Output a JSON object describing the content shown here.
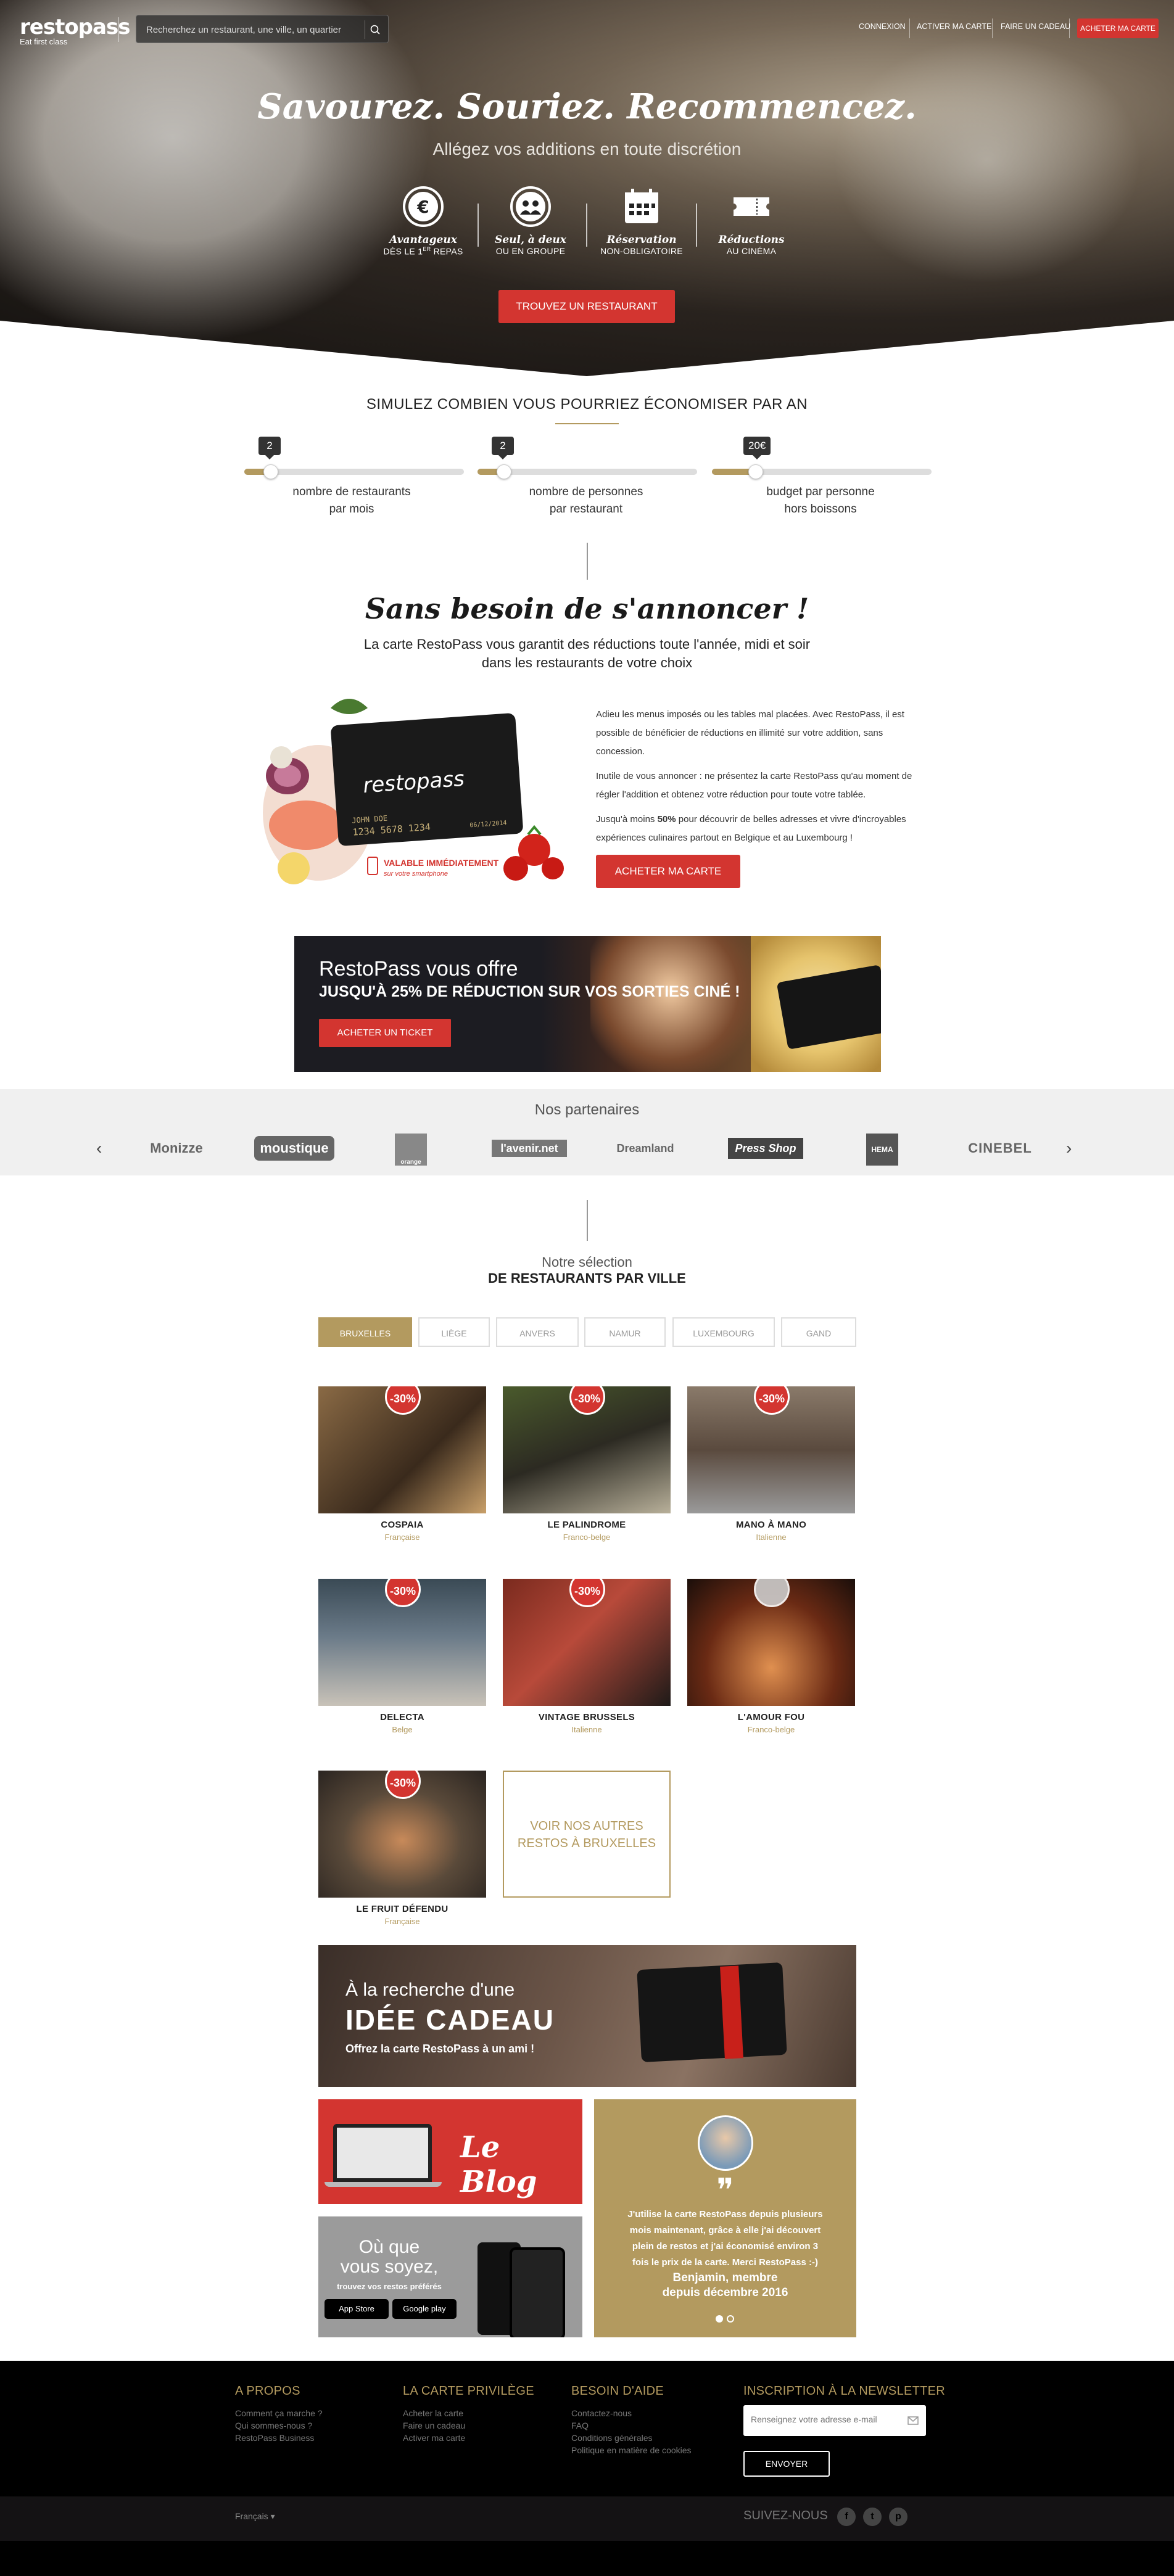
{
  "header": {
    "logo_text": "restopass",
    "logo_tagline": "Eat first class",
    "search_placeholder": "Recherchez un restaurant, une ville, un quartier",
    "nav": [
      "CONNEXION",
      "ACTIVER MA CARTE",
      "FAIRE UN CADEAU"
    ],
    "cta": "ACHETER MA CARTE"
  },
  "hero": {
    "title": "Savourez. Souriez. Recommencez.",
    "subtitle": "Allégez vos additions en toute discrétion",
    "features": [
      {
        "icon": "euro-icon",
        "title": "Avantageux",
        "sub_pre": "DÈS LE 1",
        "sup": "ER",
        "sub_post": " REPAS"
      },
      {
        "icon": "group-icon",
        "title": "Seul, à deux",
        "sub": "OU EN GROUPE"
      },
      {
        "icon": "calendar-icon",
        "title": "Réservation",
        "sub": "NON-OBLIGATOIRE"
      },
      {
        "icon": "ticket-icon",
        "title": "Réductions",
        "sub": "AU CINÉMA"
      }
    ],
    "cta": "TROUVEZ UN RESTAURANT"
  },
  "simulator": {
    "title": "SIMULEZ COMBIEN VOUS POURRIEZ ÉCONOMISER PAR AN",
    "sliders": [
      {
        "value": "2",
        "level": 0.12,
        "label1": "nombre de restaurants",
        "label2": "par mois"
      },
      {
        "value": "2",
        "level": 0.12,
        "label1": "nombre de personnes",
        "label2": "par restaurant"
      },
      {
        "value": "20€",
        "level": 0.2,
        "label1": "budget par personne",
        "label2": "hors boissons"
      }
    ]
  },
  "intro": {
    "title": "Sans besoin de s'annoncer !",
    "sub1": "La carte RestoPass vous garantit des réductions toute l'année, midi et soir",
    "sub2": "dans les restaurants de votre choix",
    "p1": "Adieu les menus imposés ou les tables mal placées. Avec RestoPass, il est possible de bénéficier de réductions en illimité sur votre addition, sans concession.",
    "p2": "Inutile de vous annoncer : ne présentez la carte RestoPass qu'au moment de régler l'addition et obtenez votre réduction pour toute votre tablée.",
    "p3_pre": "Jusqu'à moins ",
    "p3_bold": "50%",
    "p3_post": " pour découvrir de belles adresses et vivre d'incroyables expériences culinaires partout en Belgique et au Luxembourg !",
    "cta": "ACHETER MA CARTE",
    "card_brand": "restopass",
    "card_holder": "JOHN DOE",
    "card_number": "1234 5678 1234",
    "card_date": "06/12/2014",
    "valable": "VALABLE IMMÉDIATEMENT",
    "valable_sub": "sur votre smartphone"
  },
  "cinema": {
    "line1": "RestoPass vous offre",
    "line2": "JUSQU'À 25% DE RÉDUCTION SUR VOS SORTIES CINÉ !",
    "cta": "ACHETER UN TICKET"
  },
  "partners": {
    "title": "Nos partenaires",
    "logos": [
      "Monizze",
      "moustique",
      "orange",
      "l'avenir.net",
      "Dreamland",
      "Press Shop",
      "HEMA",
      "CINEBEL"
    ]
  },
  "selection": {
    "title1": "Notre sélection",
    "title2": "DE RESTAURANTS PAR VILLE",
    "tabs": [
      "BRUXELLES",
      "LIÈGE",
      "ANVERS",
      "NAMUR",
      "LUXEMBOURG",
      "GAND"
    ],
    "restaurants": [
      {
        "name": "COSPAIA",
        "type": "Française",
        "badge": "-30%"
      },
      {
        "name": "LE PALINDROME",
        "type": "Franco-belge",
        "badge": "-30%"
      },
      {
        "name": "MANO À MANO",
        "type": "Italienne",
        "badge": "-30%"
      },
      {
        "name": "DELECTA",
        "type": "Belge",
        "badge": "-30%"
      },
      {
        "name": "VINTAGE BRUSSELS",
        "type": "Italienne",
        "badge": "-30%"
      },
      {
        "name": "L'AMOUR FOU",
        "type": "Franco-belge",
        "badge": ""
      },
      {
        "name": "LE FRUIT DÉFENDU",
        "type": "Française",
        "badge": "-30%"
      }
    ],
    "more1": "VOIR NOS AUTRES",
    "more2": "RESTOS À BRUXELLES"
  },
  "gift": {
    "line1": "À la recherche d'une",
    "line2": "IDÉE CADEAU",
    "line3": "Offrez la carte RestoPass à un ami !"
  },
  "blog": {
    "title": "Le Blog"
  },
  "apps": {
    "line1": "Où que",
    "line2": "vous soyez,",
    "line3": "trouvez vos restos préférés",
    "appstore": "App Store",
    "googleplay": "Google play"
  },
  "testimonial": {
    "quote": "J'utilise la carte RestoPass depuis plusieurs mois maintenant, grâce à elle j'ai découvert plein de restos et j'ai économisé environ 3 fois le prix de la carte. Merci RestoPass :-)",
    "author": "Benjamin, membre depuis décembre 2016"
  },
  "footer": {
    "col1": {
      "title": "A PROPOS",
      "links": [
        "Comment ça marche ?",
        "Qui sommes-nous ?",
        "RestoPass Business"
      ]
    },
    "col2": {
      "title": "LA CARTE PRIVILÈGE",
      "links": [
        "Acheter la carte",
        "Faire un cadeau",
        "Activer ma carte"
      ]
    },
    "col3": {
      "title": "BESOIN D'AIDE",
      "links": [
        "Contactez-nous",
        "FAQ",
        "Conditions générales",
        "Politique en matière de cookies"
      ]
    },
    "newsletter_title": "INSCRIPTION À LA NEWSLETTER",
    "newsletter_placeholder": "Renseignez votre adresse e-mail",
    "newsletter_btn": "ENVOYER",
    "lang": "Français",
    "follow": "SUIVEZ-NOUS"
  },
  "colors": {
    "gold": "#b39a5f",
    "red": "#d33530",
    "footer": "#000000"
  }
}
